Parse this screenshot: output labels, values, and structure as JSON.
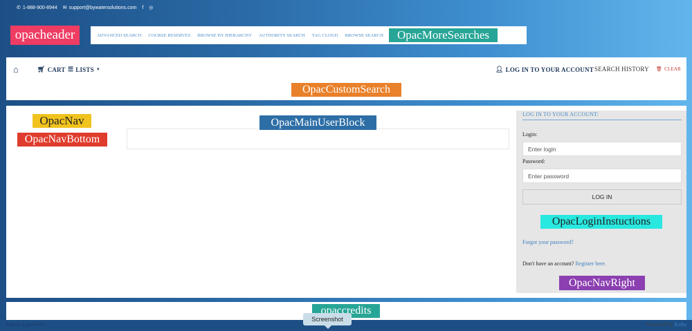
{
  "topbar": {
    "phone_icon": "phone-icon",
    "phone": "1-888-900-8944",
    "email_icon": "envelope-icon",
    "email": "support@bywatersolutions.com",
    "facebook": "f",
    "instagram": "◎"
  },
  "header": {
    "logo_label": "opacheader",
    "more_searches_label": "OpacMoreSearches",
    "links": [
      "ADVANCED SEARCH",
      "COURSE RESERVES",
      "BROWSE BY HIERARCHY",
      "AUTHORITY SEARCH",
      "TAG CLOUD",
      "BROWSE SEARCH"
    ]
  },
  "nav": {
    "home_icon": "home-icon",
    "cart": "CART",
    "lists": "LISTS",
    "login": "LOG IN TO YOUR ACCOUNT",
    "search_history": "SEARCH HISTORY",
    "clear": "CLEAR"
  },
  "custom_search_label": "OpacCustomSearch",
  "main": {
    "opacnav_label": "OpacNav",
    "opacnavbottom_label": "OpacNavBottom",
    "mainuserblock_label": "OpacMainUserBlock"
  },
  "login_panel": {
    "title": "LOG IN TO YOUR ACCOUNT:",
    "login_label": "Login:",
    "login_placeholder": "Enter login",
    "password_label": "Password:",
    "password_placeholder": "Enter password",
    "button": "LOG IN",
    "instructions_label": "OpacLoginInstuctions",
    "forgot": "Forgot your password?",
    "no_account": "Don't have an account?",
    "register": "Register here.",
    "navright_label": "OpacNavRight"
  },
  "footer": {
    "credits_label": "opaccredits",
    "report": "Report a problem",
    "powered_by": "Powered by",
    "koha": "Koha"
  },
  "tooltip": "Screenshot"
}
